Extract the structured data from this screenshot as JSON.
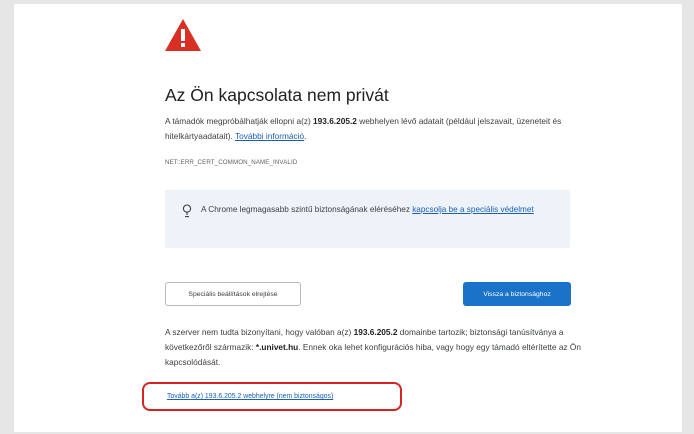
{
  "page": {
    "title": "Az Ön kapcsolata nem privát",
    "description": {
      "part1": "A támadók megpróbálhatják ellopni a(z) ",
      "host": "193.6.205.2",
      "part2": " webhelyen lévő adatait (például jelszavait, üzeneteit és hitelkártyaadatait). ",
      "learn_more": "További információ",
      "end": "."
    },
    "error_code": "NET::ERR_CERT_COMMON_NAME_INVALID",
    "enhanced_protection": {
      "text": "A Chrome legmagasabb szintű biztonságának eléréséhez ",
      "link": "kapcsolja be a speciális védelmet"
    },
    "buttons": {
      "advanced": "Speciális beállítások elrejtése",
      "back": "Vissza a biztonsághoz"
    },
    "details": {
      "part1": "A szerver nem tudta bizonyítani, hogy valóban a(z) ",
      "host": "193.6.205.2",
      "part2": " domainbe tartozik; biztonsági tanúsítványa a következőről származik: ",
      "cert_domain": "*.univet.hu",
      "part3": ". Ennek oka lehet konfigurációs hiba, vagy hogy egy támadó eltérítette az Ön kapcsolódását."
    },
    "proceed_link": "Tovább a(z) 193.6.205.2 webhelyre (nem biztonságos)"
  },
  "colors": {
    "warning_red": "#d93025",
    "link_blue": "#1a5fb4",
    "primary_button": "#1a73c8",
    "highlight_border": "#d62323",
    "info_box_bg": "#eef3f9"
  },
  "icons": {
    "warning": "warning-triangle-icon",
    "bulb": "lightbulb-icon"
  }
}
